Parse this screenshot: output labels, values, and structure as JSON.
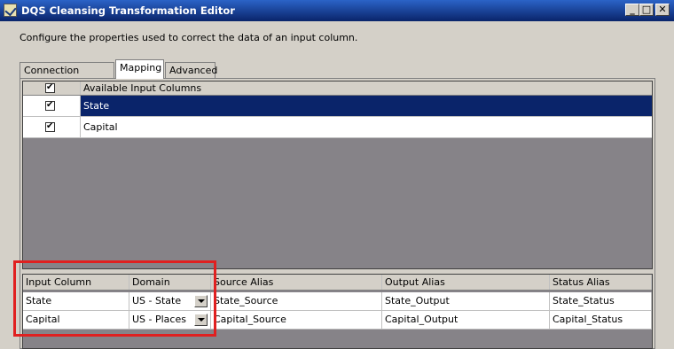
{
  "window": {
    "title": "DQS Cleansing Transformation Editor",
    "buttons": {
      "minimize": "_",
      "maximize": "□",
      "close": "✕"
    }
  },
  "description": "Configure the properties used to correct the data of an input column.",
  "tabs": [
    {
      "label": "Connection Manager",
      "active": false
    },
    {
      "label": "Mapping",
      "active": true
    },
    {
      "label": "Advanced",
      "active": false
    }
  ],
  "available_columns": {
    "header": "Available Input Columns",
    "header_checked": true,
    "rows": [
      {
        "name": "State",
        "checked": true,
        "selected": true
      },
      {
        "name": "Capital",
        "checked": true,
        "selected": false
      }
    ]
  },
  "mapping": {
    "headers": [
      "Input Column",
      "Domain",
      "Source Alias",
      "Output Alias",
      "Status Alias"
    ],
    "rows": [
      {
        "input": "State",
        "domain": "US - State",
        "source": "State_Source",
        "output": "State_Output",
        "status": "State_Status"
      },
      {
        "input": "Capital",
        "domain": "US - Places",
        "source": "Capital_Source",
        "output": "Capital_Output",
        "status": "Capital_Status"
      }
    ]
  },
  "colors": {
    "selection": "#0a246a",
    "highlight_box": "#e02020",
    "grid_background": "#868388"
  }
}
